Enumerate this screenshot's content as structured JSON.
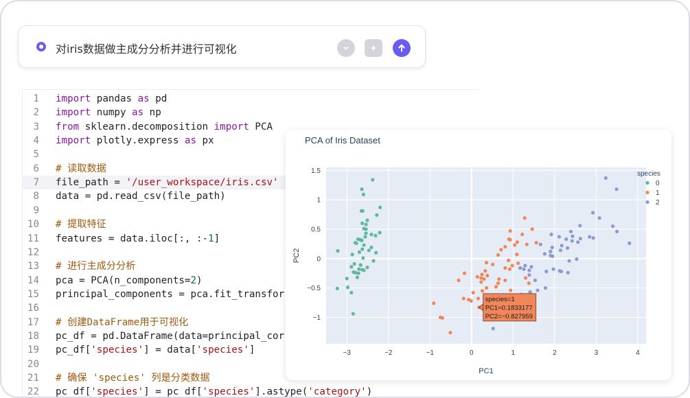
{
  "prompt": {
    "text": "对iris数据做主成分分析并进行可视化"
  },
  "code_lines": [
    {
      "n": "1",
      "segs": [
        [
          "kw",
          "import"
        ],
        [
          "t",
          " pandas "
        ],
        [
          "kw",
          "as"
        ],
        [
          "t",
          " pd"
        ]
      ]
    },
    {
      "n": "2",
      "segs": [
        [
          "kw",
          "import"
        ],
        [
          "t",
          " numpy "
        ],
        [
          "kw",
          "as"
        ],
        [
          "t",
          " np"
        ]
      ]
    },
    {
      "n": "3",
      "segs": [
        [
          "kw",
          "from"
        ],
        [
          "t",
          " sklearn.decomposition "
        ],
        [
          "kw",
          "import"
        ],
        [
          "t",
          " PCA"
        ]
      ]
    },
    {
      "n": "4",
      "segs": [
        [
          "kw",
          "import"
        ],
        [
          "t",
          " plotly.express "
        ],
        [
          "kw",
          "as"
        ],
        [
          "t",
          " px"
        ]
      ]
    },
    {
      "n": "5",
      "segs": []
    },
    {
      "n": "6",
      "segs": [
        [
          "cm",
          "# 读取数据"
        ]
      ]
    },
    {
      "n": "7",
      "segs": [
        [
          "t",
          "file_path = "
        ],
        [
          "str",
          "'/user_workspace/iris.csv'"
        ]
      ],
      "highlight": true
    },
    {
      "n": "8",
      "segs": [
        [
          "t",
          "data = pd.read_csv(file_path)"
        ]
      ]
    },
    {
      "n": "9",
      "segs": []
    },
    {
      "n": "10",
      "segs": [
        [
          "cm",
          "# 提取特征"
        ]
      ]
    },
    {
      "n": "11",
      "segs": [
        [
          "t",
          "features = data.iloc[:, :-"
        ],
        [
          "num",
          "1"
        ],
        [
          "t",
          "]"
        ]
      ]
    },
    {
      "n": "12",
      "segs": []
    },
    {
      "n": "13",
      "segs": [
        [
          "cm",
          "# 进行主成分分析"
        ]
      ]
    },
    {
      "n": "14",
      "segs": [
        [
          "t",
          "pca = PCA(n_components="
        ],
        [
          "num",
          "2"
        ],
        [
          "t",
          ")"
        ]
      ]
    },
    {
      "n": "15",
      "segs": [
        [
          "t",
          "principal_components = pca.fit_transfor"
        ]
      ]
    },
    {
      "n": "16",
      "segs": []
    },
    {
      "n": "17",
      "segs": [
        [
          "cm",
          "# 创建DataFrame用于可视化"
        ]
      ]
    },
    {
      "n": "18",
      "segs": [
        [
          "t",
          "pc_df = pd.DataFrame(data=principal_cor"
        ]
      ]
    },
    {
      "n": "19",
      "segs": [
        [
          "t",
          "pc_df["
        ],
        [
          "str",
          "'species'"
        ],
        [
          "t",
          "] = data["
        ],
        [
          "str",
          "'species'"
        ],
        [
          "t",
          "]"
        ]
      ]
    },
    {
      "n": "20",
      "segs": []
    },
    {
      "n": "21",
      "segs": [
        [
          "cm",
          "# 确保 'species' 列是分类数据"
        ]
      ]
    },
    {
      "n": "22",
      "segs": [
        [
          "t",
          "pc_df["
        ],
        [
          "str",
          "'species'"
        ],
        [
          "t",
          "] = pc_df["
        ],
        [
          "str",
          "'species'"
        ],
        [
          "t",
          "].astype("
        ],
        [
          "str",
          "'category'"
        ],
        [
          "t",
          ")"
        ]
      ]
    }
  ],
  "chart_data": {
    "type": "scatter",
    "title": "PCA of Iris Dataset",
    "xlabel": "PC1",
    "ylabel": "PC2",
    "xlim": [
      -3.5,
      4.2
    ],
    "ylim": [
      -1.45,
      1.55
    ],
    "x_ticks": [
      -3,
      -2,
      -1,
      0,
      1,
      2,
      3,
      4
    ],
    "y_ticks": [
      -1,
      -0.5,
      0,
      0.5,
      1,
      1.5
    ],
    "x_tick_labels": [
      "−3",
      "−2",
      "−1",
      "0",
      "1",
      "2",
      "3",
      "4"
    ],
    "y_tick_labels": [
      "−1",
      "−0.5",
      "0",
      "0.5",
      "1",
      "1.5"
    ],
    "grid": true,
    "legend_title": "species",
    "legend_position": "right",
    "series": [
      {
        "name": "0",
        "color": "#5fb89a",
        "points": [
          [
            -2.68,
            0.32
          ],
          [
            -2.71,
            -0.18
          ],
          [
            -2.89,
            -0.14
          ],
          [
            -2.75,
            -0.32
          ],
          [
            -2.73,
            0.33
          ],
          [
            -2.28,
            0.74
          ],
          [
            -2.82,
            -0.09
          ],
          [
            -2.63,
            0.16
          ],
          [
            -2.89,
            -0.58
          ],
          [
            -2.67,
            -0.11
          ],
          [
            -2.51,
            0.65
          ],
          [
            -2.61,
            0.01
          ],
          [
            -2.79,
            -0.24
          ],
          [
            -3.23,
            -0.51
          ],
          [
            -2.64,
            1.18
          ],
          [
            -2.38,
            1.34
          ],
          [
            -2.62,
            0.81
          ],
          [
            -2.65,
            0.31
          ],
          [
            -2.2,
            0.87
          ],
          [
            -2.59,
            0.51
          ],
          [
            -2.31,
            0.39
          ],
          [
            -2.54,
            0.43
          ],
          [
            -3.22,
            0.13
          ],
          [
            -2.3,
            0.1
          ],
          [
            -2.36,
            -0.04
          ],
          [
            -2.51,
            -0.15
          ],
          [
            -2.47,
            0.14
          ],
          [
            -2.56,
            0.37
          ],
          [
            -2.64,
            0.31
          ],
          [
            -2.63,
            -0.19
          ],
          [
            -2.59,
            -0.2
          ],
          [
            -2.41,
            0.41
          ],
          [
            -2.65,
            0.81
          ],
          [
            -2.6,
            1.09
          ],
          [
            -2.67,
            -0.11
          ],
          [
            -2.87,
            0.07
          ],
          [
            -2.63,
            0.6
          ],
          [
            -2.8,
            0.27
          ],
          [
            -2.98,
            -0.49
          ],
          [
            -2.59,
            0.23
          ],
          [
            -2.77,
            0.26
          ],
          [
            -2.85,
            -0.94
          ],
          [
            -3.0,
            -0.34
          ],
          [
            -2.41,
            0.19
          ],
          [
            -2.21,
            0.44
          ],
          [
            -2.72,
            -0.25
          ],
          [
            -2.54,
            0.5
          ],
          [
            -2.84,
            -0.23
          ],
          [
            -2.54,
            0.58
          ],
          [
            -2.7,
            0.11
          ]
        ]
      },
      {
        "name": "1",
        "color": "#f0875a",
        "points": [
          [
            1.28,
            0.69
          ],
          [
            0.93,
            0.32
          ],
          [
            1.46,
            0.5
          ],
          [
            0.18,
            -0.83
          ],
          [
            1.09,
            0.07
          ],
          [
            0.64,
            -0.42
          ],
          [
            1.1,
            0.28
          ],
          [
            -0.75,
            -1.0
          ],
          [
            1.04,
            0.23
          ],
          [
            -0.01,
            -0.72
          ],
          [
            -0.51,
            -1.26
          ],
          [
            0.51,
            -0.1
          ],
          [
            0.26,
            -0.55
          ],
          [
            0.98,
            -0.12
          ],
          [
            -0.17,
            -0.25
          ],
          [
            0.93,
            0.47
          ],
          [
            0.66,
            -0.35
          ],
          [
            0.23,
            -0.33
          ],
          [
            0.94,
            -0.54
          ],
          [
            0.04,
            -0.58
          ],
          [
            1.12,
            -0.08
          ],
          [
            0.36,
            -0.07
          ],
          [
            1.3,
            -0.33
          ],
          [
            0.92,
            -0.18
          ],
          [
            0.71,
            0.15
          ],
          [
            0.9,
            0.33
          ],
          [
            1.33,
            0.24
          ],
          [
            1.56,
            0.27
          ],
          [
            0.81,
            -0.16
          ],
          [
            -0.31,
            -0.37
          ],
          [
            -0.07,
            -0.7
          ],
          [
            -0.19,
            -0.68
          ],
          [
            0.14,
            -0.31
          ],
          [
            1.38,
            -0.42
          ],
          [
            0.59,
            -0.48
          ],
          [
            0.81,
            0.2
          ],
          [
            1.22,
            0.41
          ],
          [
            0.81,
            -0.37
          ],
          [
            0.25,
            -0.27
          ],
          [
            0.16,
            -0.68
          ],
          [
            0.46,
            -0.67
          ],
          [
            0.89,
            -0.03
          ],
          [
            0.23,
            -0.4
          ],
          [
            -0.7,
            -1.01
          ],
          [
            0.36,
            -0.5
          ],
          [
            0.33,
            -0.21
          ],
          [
            0.38,
            -0.29
          ],
          [
            0.64,
            0.06
          ],
          [
            -0.91,
            -0.76
          ],
          [
            0.3,
            -0.35
          ]
        ]
      },
      {
        "name": "2",
        "color": "#8b9ad0",
        "points": [
          [
            2.53,
            -0.01
          ],
          [
            1.41,
            -0.57
          ],
          [
            2.62,
            0.34
          ],
          [
            1.97,
            -0.18
          ],
          [
            2.35,
            -0.04
          ],
          [
            3.4,
            0.55
          ],
          [
            0.52,
            -1.19
          ],
          [
            2.93,
            0.35
          ],
          [
            2.32,
            -0.24
          ],
          [
            2.92,
            0.78
          ],
          [
            1.66,
            0.24
          ],
          [
            1.8,
            -0.22
          ],
          [
            2.17,
            0.22
          ],
          [
            1.34,
            -0.78
          ],
          [
            1.59,
            -0.54
          ],
          [
            1.9,
            0.12
          ],
          [
            1.95,
            0.04
          ],
          [
            3.49,
            1.18
          ],
          [
            3.8,
            0.26
          ],
          [
            1.3,
            -0.76
          ],
          [
            2.43,
            0.38
          ],
          [
            1.2,
            -0.61
          ],
          [
            3.5,
            0.46
          ],
          [
            1.39,
            -0.2
          ],
          [
            2.28,
            0.33
          ],
          [
            2.61,
            0.56
          ],
          [
            1.26,
            -0.18
          ],
          [
            1.29,
            -0.12
          ],
          [
            2.12,
            -0.21
          ],
          [
            2.39,
            0.46
          ],
          [
            2.84,
            0.37
          ],
          [
            3.23,
            1.37
          ],
          [
            2.16,
            -0.22
          ],
          [
            1.44,
            -0.14
          ],
          [
            1.78,
            -0.5
          ],
          [
            3.08,
            0.69
          ],
          [
            2.14,
            0.14
          ],
          [
            1.9,
            0.05
          ],
          [
            1.17,
            -0.16
          ],
          [
            2.11,
            0.37
          ],
          [
            2.31,
            0.18
          ],
          [
            1.92,
            0.41
          ],
          [
            1.41,
            -0.57
          ],
          [
            2.56,
            0.28
          ],
          [
            2.42,
            0.3
          ],
          [
            1.94,
            0.19
          ],
          [
            1.53,
            -0.37
          ],
          [
            1.76,
            0.08
          ],
          [
            1.9,
            0.12
          ],
          [
            1.39,
            -0.28
          ]
        ]
      }
    ],
    "tooltip": {
      "lines": [
        "species=1",
        "PC1=0.1833177",
        "PC2=−0.827959"
      ],
      "point_series": "1",
      "point": [
        0.18,
        -0.83
      ]
    }
  }
}
